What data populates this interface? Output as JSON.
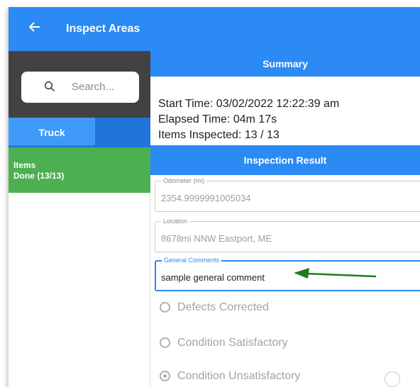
{
  "appbar": {
    "title": "Inspect Areas",
    "back_icon": "arrow-left-icon"
  },
  "search": {
    "placeholder": "Search...",
    "icon": "search-icon"
  },
  "tabs": [
    {
      "label": "Truck",
      "selected": true
    }
  ],
  "items_status": {
    "line1": "Items",
    "line2": "Done (13/13)"
  },
  "summary": {
    "header": "Summary",
    "start_time": "Start Time: 03/02/2022 12:22:39 am",
    "elapsed_time": "Elapsed Time: 04m 17s",
    "items_inspected": "Items Inspected: 13 / 13"
  },
  "inspection_result": {
    "header": "Inspection Result",
    "odometer": {
      "label": "Odometer (mi)",
      "value": "2354.9999991005034"
    },
    "location": {
      "label": "Location",
      "value": "8678mi NNW Eastport, ME"
    },
    "general_comments": {
      "label": "General Comments",
      "value": "sample general comment"
    },
    "options": [
      {
        "label": "Defects Corrected",
        "selected": false
      },
      {
        "label": "Condition Satisfactory",
        "selected": false
      },
      {
        "label": "Condition Unsatisfactory",
        "selected": true
      }
    ]
  },
  "colors": {
    "primary": "#2b8af3",
    "dark_panel": "#424242",
    "done_green": "#4caf50",
    "annotation_arrow": "#1e7d1e"
  }
}
